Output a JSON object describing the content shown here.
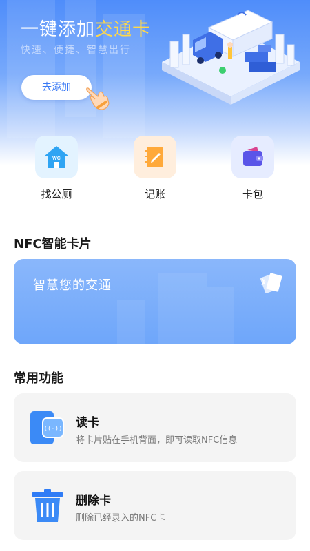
{
  "hero": {
    "title_prefix": "一键添加",
    "title_highlight": "交通卡",
    "subtitle": "快速、便捷、智慧出行",
    "add_button": "去添加"
  },
  "quick_actions": [
    {
      "label": "找公厕",
      "icon": "wc-house-icon",
      "badge": "WC"
    },
    {
      "label": "记账",
      "icon": "notebook-pen-icon"
    },
    {
      "label": "卡包",
      "icon": "wallet-icon"
    }
  ],
  "nfc_section": {
    "title": "NFC智能卡片",
    "card_text": "智慧您的交通"
  },
  "common_section": {
    "title": "常用功能",
    "items": [
      {
        "title": "读卡",
        "desc": "将卡片贴在手机背面，即可读取NFC信息",
        "icon": "phone-nfc-icon"
      },
      {
        "title": "删除卡",
        "desc": "删除已经录入的NFC卡",
        "icon": "trash-icon"
      }
    ]
  },
  "colors": {
    "accent": "#3b7af5",
    "highlight": "#ffd84a",
    "card_bg": "#f4f4f4"
  }
}
